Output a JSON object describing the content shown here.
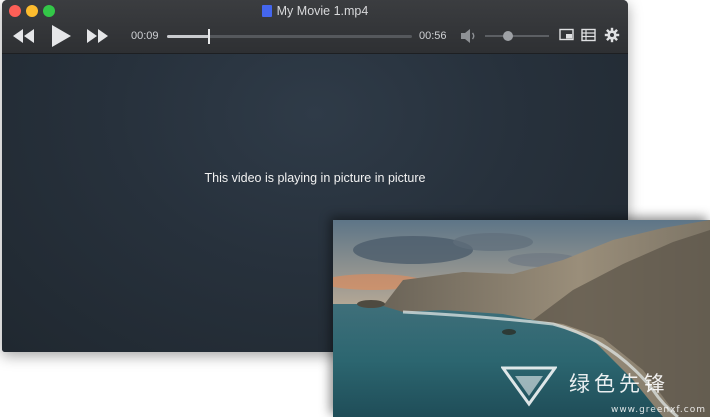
{
  "window": {
    "title": "My Movie 1.mp4",
    "controls": {
      "rewind_icon": "rewind-icon",
      "play_icon": "play-icon",
      "fast_forward_icon": "fast-forward-icon",
      "elapsed_time": "00:09",
      "total_time": "00:56",
      "progress_fraction": 0.17,
      "volume_icon": "speaker-icon",
      "volume_level": 0.36,
      "pip_icon": "picture-in-picture-icon",
      "playlist_icon": "list-icon",
      "settings_icon": "gear-icon"
    }
  },
  "video": {
    "message": "This video is playing in picture in picture"
  },
  "pip": {
    "scene": "coastal-cliffs-sunset"
  },
  "watermark": {
    "text": "绿色先锋",
    "url": "www.greenxf.com"
  },
  "colors": {
    "close": "#fc5f57",
    "minimize": "#fdbc2e",
    "maximize": "#33c748"
  }
}
